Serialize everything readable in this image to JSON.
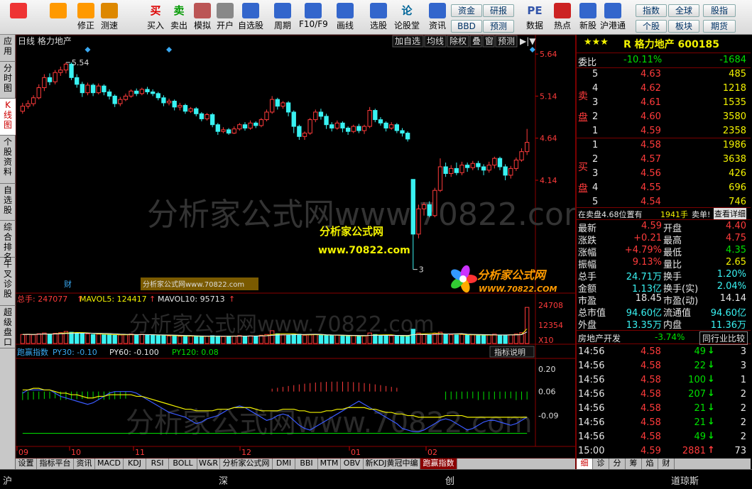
{
  "toolbar": {
    "buttons": [
      {
        "label": "",
        "icon": "app-logo-icon"
      },
      {
        "label": "",
        "icon": "back-arrow-icon"
      },
      {
        "label": "修正",
        "icon": "up-down-icon"
      },
      {
        "label": "测速",
        "icon": "speed-icon"
      },
      {
        "label": "买入",
        "icon": "buy-icon",
        "glyph": "买"
      },
      {
        "label": "卖出",
        "icon": "sell-icon",
        "glyph": "卖"
      },
      {
        "label": "模拟",
        "icon": "hammer-icon"
      },
      {
        "label": "开户",
        "icon": "lock-icon"
      },
      {
        "label": "自选股",
        "icon": "star-folder-icon"
      },
      {
        "label": "周期",
        "icon": "clock-icon"
      },
      {
        "label": "F10/F9",
        "icon": "f10-icon"
      },
      {
        "label": "画线",
        "icon": "pen-icon"
      },
      {
        "label": "选股",
        "icon": "select-stock-icon"
      },
      {
        "label": "论股堂",
        "icon": "forum-icon",
        "glyph": "论"
      },
      {
        "label": "资讯",
        "icon": "info-icon"
      },
      {
        "label": "数据",
        "icon": "data-pe-icon",
        "glyph": "PE"
      },
      {
        "label": "热点",
        "icon": "hot-icon"
      },
      {
        "label": "新股",
        "icon": "new-stock-icon"
      },
      {
        "label": "沪港通",
        "icon": "sse-hke-icon"
      }
    ],
    "small_buttons": [
      "资金",
      "研报",
      "指数",
      "全球",
      "股指",
      "BBD",
      "预测",
      "个股",
      "板块",
      "期货"
    ]
  },
  "sidetabs": [
    "应用",
    "分时图",
    "K线图",
    "个股资料",
    "自选股",
    "综合排名",
    "牛叉诊股",
    "超级盘口"
  ],
  "chart": {
    "stock_label": "日线  格力地产",
    "right_buttons": [
      "加自选",
      "均线",
      "除权",
      "叠",
      "窗",
      "预测"
    ],
    "price_axis": [
      "5.64",
      "5.14",
      "4.64",
      "4.14"
    ],
    "high_mark": "5.54",
    "low_mark": "3",
    "cai_label": "财",
    "watermark": "分析家公式网www.70822.com",
    "overlay_title": "分析家公式网",
    "overlay_url": "www.70822.com",
    "logo_text": "分析家公式网",
    "logo_url": "WWW.70822.COM",
    "small_link": "分析家公式网www.70822.com",
    "vol_legend": {
      "total": "总手: 247077",
      "ma5": "MAVOL5: 124417",
      "ma10": "MAVOL10: 95713"
    },
    "vol_axis": [
      "24708",
      "12354",
      "X10"
    ],
    "ind_legend": {
      "name": "跑赢指数",
      "py30": "PY30: -0.10",
      "py60": "PY60: -0.100",
      "py120": "PY120: 0.08"
    },
    "ind_button": "指标说明",
    "ind_axis": [
      "0.20",
      "0.06",
      "-0.09"
    ],
    "date_axis": [
      "09",
      "10",
      "11",
      "12",
      "01",
      "02"
    ]
  },
  "chart_data": {
    "type": "candlestick",
    "ylim": [
      2.9,
      5.7
    ],
    "candles": [
      [
        4.96,
        5.02,
        5.06,
        4.93
      ],
      [
        5.02,
        5.05,
        5.09,
        4.99
      ],
      [
        5.05,
        5.12,
        5.15,
        5.02
      ],
      [
        5.12,
        5.24,
        5.28,
        5.1
      ],
      [
        5.24,
        5.36,
        5.4,
        5.2
      ],
      [
        5.36,
        5.31,
        5.41,
        5.27
      ],
      [
        5.31,
        5.42,
        5.45,
        5.28
      ],
      [
        5.42,
        5.45,
        5.49,
        5.38
      ],
      [
        5.45,
        5.52,
        5.54,
        5.41
      ],
      [
        5.52,
        5.36,
        5.54,
        5.33
      ],
      [
        5.36,
        5.28,
        5.4,
        5.24
      ],
      [
        5.28,
        5.18,
        5.31,
        5.13
      ],
      [
        5.18,
        5.27,
        5.3,
        5.15
      ],
      [
        5.27,
        5.18,
        5.29,
        5.14
      ],
      [
        5.18,
        5.26,
        5.29,
        5.16
      ],
      [
        5.26,
        5.19,
        5.28,
        5.15
      ],
      [
        5.19,
        5.14,
        5.22,
        5.1
      ],
      [
        5.14,
        5.05,
        5.16,
        5.01
      ],
      [
        5.05,
        5.1,
        5.13,
        5.02
      ],
      [
        5.1,
        5.14,
        5.17,
        5.08
      ],
      [
        5.14,
        5.2,
        5.22,
        5.12
      ],
      [
        5.2,
        5.17,
        5.23,
        5.14
      ],
      [
        5.17,
        5.22,
        5.24,
        5.15
      ],
      [
        5.22,
        5.19,
        5.25,
        5.16
      ],
      [
        5.19,
        5.17,
        5.22,
        5.14
      ],
      [
        5.17,
        5.12,
        5.19,
        5.09
      ],
      [
        5.12,
        5.06,
        5.15,
        5.02
      ],
      [
        5.06,
        5.08,
        5.11,
        5.03
      ],
      [
        5.08,
        5.01,
        5.1,
        4.97
      ],
      [
        5.01,
        5.03,
        5.06,
        4.97
      ],
      [
        5.03,
        4.96,
        5.05,
        4.93
      ],
      [
        4.96,
        4.99,
        5.01,
        4.94
      ],
      [
        4.99,
        4.93,
        5.01,
        4.9
      ],
      [
        4.93,
        4.87,
        4.95,
        4.84
      ],
      [
        4.87,
        4.92,
        4.94,
        4.85
      ],
      [
        4.92,
        4.8,
        4.94,
        4.77
      ],
      [
        4.8,
        4.72,
        4.82,
        4.68
      ],
      [
        4.72,
        4.74,
        4.77,
        4.7
      ],
      [
        4.74,
        4.7,
        4.76,
        4.68
      ],
      [
        4.7,
        4.75,
        4.78,
        4.69
      ],
      [
        4.75,
        4.8,
        4.82,
        4.73
      ],
      [
        4.8,
        4.76,
        4.83,
        4.73
      ],
      [
        4.76,
        4.82,
        4.85,
        4.74
      ],
      [
        4.82,
        4.79,
        4.84,
        4.76
      ],
      [
        4.79,
        4.86,
        4.88,
        4.77
      ],
      [
        4.86,
        4.95,
        4.98,
        4.84
      ],
      [
        4.95,
        5.1,
        5.14,
        4.93
      ],
      [
        5.1,
        5.02,
        5.12,
        4.98
      ],
      [
        5.02,
        5.06,
        5.08,
        4.99
      ],
      [
        5.06,
        4.95,
        5.08,
        4.9
      ],
      [
        4.95,
        4.78,
        4.97,
        4.7
      ],
      [
        4.78,
        4.66,
        4.8,
        4.62
      ],
      [
        4.66,
        4.7,
        4.72,
        4.62
      ],
      [
        4.7,
        4.86,
        4.88,
        4.68
      ],
      [
        4.86,
        4.95,
        4.98,
        4.83
      ],
      [
        4.95,
        4.9,
        4.99,
        4.86
      ],
      [
        4.9,
        4.8,
        4.93,
        4.75
      ],
      [
        4.8,
        4.76,
        4.83,
        4.72
      ],
      [
        4.76,
        4.82,
        4.85,
        4.74
      ],
      [
        4.82,
        4.76,
        4.84,
        4.71
      ],
      [
        4.76,
        4.72,
        4.78,
        4.68
      ],
      [
        4.72,
        4.78,
        4.8,
        4.7
      ],
      [
        4.78,
        4.73,
        4.81,
        4.7
      ],
      [
        4.73,
        4.78,
        4.8,
        4.69
      ],
      [
        4.78,
        4.97,
        5.01,
        4.76
      ],
      [
        4.97,
        4.86,
        4.99,
        4.83
      ],
      [
        4.86,
        4.82,
        4.89,
        4.79
      ],
      [
        4.82,
        4.76,
        4.84,
        4.72
      ],
      [
        4.76,
        4.8,
        4.83,
        4.74
      ],
      [
        4.8,
        4.73,
        4.82,
        4.7
      ],
      [
        4.73,
        4.7,
        4.76,
        4.66
      ],
      [
        4.7,
        4.63,
        4.72,
        4.6
      ],
      [
        4.15,
        3.5,
        4.15,
        3.08
      ],
      [
        3.5,
        3.8,
        3.85,
        3.45
      ],
      [
        3.8,
        3.85,
        3.88,
        3.72
      ],
      [
        3.85,
        3.72,
        3.89,
        3.7
      ],
      [
        3.72,
        4.02,
        4.05,
        3.7
      ],
      [
        4.02,
        4.3,
        4.4,
        4.0
      ],
      [
        4.3,
        4.22,
        4.35,
        4.18
      ],
      [
        4.22,
        4.28,
        4.32,
        4.18
      ],
      [
        4.28,
        4.23,
        4.35,
        4.2
      ],
      [
        4.23,
        4.32,
        4.36,
        4.2
      ],
      [
        4.32,
        4.29,
        4.35,
        4.24
      ],
      [
        4.29,
        4.34,
        4.37,
        4.26
      ],
      [
        4.34,
        4.3,
        4.37,
        4.26
      ],
      [
        4.3,
        4.26,
        4.33,
        4.2
      ],
      [
        4.26,
        4.32,
        4.36,
        4.23
      ],
      [
        4.32,
        4.4,
        4.42,
        4.28
      ],
      [
        4.4,
        4.3,
        4.42,
        4.26
      ],
      [
        4.3,
        4.2,
        4.33,
        4.14
      ],
      [
        4.2,
        4.28,
        4.31,
        4.16
      ],
      [
        4.28,
        4.38,
        4.41,
        4.25
      ],
      [
        4.38,
        4.48,
        4.52,
        4.36
      ],
      [
        4.48,
        4.59,
        4.75,
        4.44
      ]
    ],
    "volume": [
      60,
      62,
      58,
      65,
      70,
      60,
      68,
      72,
      80,
      75,
      70,
      66,
      64,
      60,
      62,
      58,
      60,
      55,
      57,
      60,
      63,
      58,
      61,
      57,
      55,
      52,
      54,
      50,
      52,
      48,
      50,
      49,
      47,
      46,
      48,
      52,
      50,
      46,
      48,
      50,
      53,
      49,
      51,
      48,
      55,
      60,
      85,
      65,
      58,
      55,
      60,
      62,
      55,
      58,
      60,
      56,
      54,
      52,
      55,
      50,
      49,
      52,
      50,
      51,
      70,
      60,
      55,
      52,
      51,
      50,
      49,
      48,
      95,
      70,
      60,
      58,
      65,
      75,
      60,
      58,
      57,
      60,
      56,
      58,
      55,
      53,
      57,
      62,
      56,
      55,
      58,
      63,
      72,
      240
    ],
    "volume_ylim": [
      0,
      250
    ],
    "vol_series": [
      {
        "name": "MAVOL5"
      },
      {
        "name": "MAVOL10"
      }
    ],
    "indicator": {
      "ylim": [
        -0.26,
        0.24
      ],
      "py30": [
        0.05,
        0.07,
        0.07,
        0.07,
        0.07,
        0.07,
        0.05,
        0.03,
        0.02,
        0.01,
        0.0,
        -0.01,
        -0.02,
        -0.01,
        0.01,
        0.03,
        0.05,
        0.06,
        0.06,
        0.06,
        0.06,
        0.05,
        0.03,
        0.01,
        -0.01,
        -0.03,
        -0.05,
        -0.07,
        -0.08,
        -0.09,
        -0.1,
        -0.12,
        -0.14,
        -0.13,
        -0.11,
        -0.1,
        -0.09,
        -0.07,
        -0.05,
        -0.04,
        -0.03,
        -0.04,
        -0.06,
        -0.08,
        -0.1,
        -0.12,
        -0.11,
        -0.09,
        -0.08,
        -0.09,
        -0.12,
        -0.15,
        -0.17,
        -0.18,
        -0.16,
        -0.14,
        -0.12,
        -0.1,
        -0.08,
        -0.06,
        -0.04,
        -0.02,
        0.0,
        -0.02,
        -0.04,
        -0.06,
        -0.08,
        -0.1,
        -0.12,
        -0.14,
        -0.17,
        -0.18,
        -0.19,
        -0.19,
        -0.18,
        -0.16,
        -0.14,
        -0.12,
        -0.11,
        -0.12,
        -0.14,
        -0.16,
        -0.18,
        -0.17,
        -0.15,
        -0.13,
        -0.12,
        -0.12,
        -0.13,
        -0.14,
        -0.15,
        -0.14,
        -0.12,
        -0.1
      ],
      "py60": [
        0.07,
        0.07,
        0.08,
        0.08,
        0.07,
        0.07,
        0.06,
        0.05,
        0.05,
        0.04,
        0.04,
        0.03,
        0.02,
        0.02,
        0.03,
        0.03,
        0.04,
        0.04,
        0.04,
        0.04,
        0.04,
        0.03,
        0.03,
        0.02,
        0.01,
        0.0,
        -0.01,
        -0.02,
        -0.03,
        -0.04,
        -0.05,
        -0.05,
        -0.06,
        -0.06,
        -0.06,
        -0.06,
        -0.05,
        -0.05,
        -0.05,
        -0.04,
        -0.04,
        -0.04,
        -0.04,
        -0.05,
        -0.06,
        -0.06,
        -0.06,
        -0.06,
        -0.05,
        -0.05,
        -0.05,
        -0.06,
        -0.06,
        -0.07,
        -0.07,
        -0.07,
        -0.06,
        -0.06,
        -0.05,
        -0.05,
        -0.04,
        -0.04,
        -0.04,
        -0.04,
        -0.05,
        -0.05,
        -0.06,
        -0.07,
        -0.07,
        -0.08,
        -0.08,
        -0.09,
        -0.09,
        -0.1,
        -0.1,
        -0.1,
        -0.1,
        -0.1,
        -0.09,
        -0.09,
        -0.09,
        -0.09,
        -0.1,
        -0.1,
        -0.1,
        -0.1,
        -0.1,
        -0.1,
        -0.1,
        -0.1,
        -0.1,
        -0.1,
        -0.1,
        -0.1
      ],
      "py120": 0.08,
      "hist": [
        0.0,
        0.0,
        0.0,
        -0.02,
        -0.02,
        -0.03,
        -0.02,
        -0.02,
        -0.02,
        -0.02,
        -0.02,
        -0.02,
        -0.02,
        -0.02,
        -0.02,
        -0.02,
        -0.02,
        -0.02,
        -0.02,
        -0.02,
        -0.01,
        -0.01,
        -0.01,
        -0.01,
        -0.01,
        0.0,
        0.0,
        0.0,
        0.0,
        0.0,
        0.0,
        0.0,
        0.0,
        0.0,
        0.0,
        0.0,
        0.0,
        0.0,
        0.0,
        0.0,
        0.0,
        0.0,
        0.0,
        0.0,
        0.0,
        0.0,
        0.0,
        0.0,
        0.0,
        0.0,
        0.0,
        0.0,
        0.0,
        0.0,
        0.0,
        0.0,
        0.0,
        0.0,
        0.0,
        0.0,
        0.0,
        0.0,
        0.0,
        0.0,
        0.0,
        0.0,
        0.0,
        0.0,
        0.0,
        0.0,
        0.0,
        0.0,
        0.0,
        0.0,
        0.0,
        0.0,
        0.0,
        0.0,
        0.0,
        0.0,
        0.0,
        0.0,
        0.0,
        0.0,
        0.0,
        0.0,
        0.0,
        0.0,
        0.0,
        0.0,
        0.0,
        0.0,
        0.0,
        0.0
      ],
      "hist_pos": [
        0,
        0,
        0,
        0,
        0,
        0,
        0,
        0,
        0,
        0,
        0,
        0,
        0,
        0,
        0,
        0,
        0,
        0,
        0,
        0,
        0,
        0,
        0,
        0,
        0,
        0,
        0,
        0,
        0,
        0,
        0,
        0,
        0,
        0,
        0,
        0,
        0,
        0,
        0,
        0,
        0,
        0,
        0,
        0,
        0,
        0,
        0,
        0,
        0,
        0,
        0,
        0,
        0,
        0,
        0,
        0,
        0,
        0,
        0,
        0,
        0,
        0,
        0,
        0,
        0,
        0,
        0,
        0,
        0,
        0,
        0,
        0,
        0,
        0,
        0,
        0,
        0,
        0,
        0,
        0,
        0,
        0,
        0,
        0,
        0,
        0,
        0,
        0,
        0,
        0,
        0,
        0,
        0,
        0
      ]
    }
  },
  "right": {
    "title": "R 格力地产 600185",
    "stars": "★★★",
    "weibi": {
      "label": "委比",
      "pct": "-10.11%",
      "val": "-1684"
    },
    "sell_label": "卖盘",
    "buy_label": "买盘",
    "asks": [
      {
        "lv": "5",
        "p": "4.63",
        "v": "485"
      },
      {
        "lv": "4",
        "p": "4.62",
        "v": "1218"
      },
      {
        "lv": "3",
        "p": "4.61",
        "v": "1535"
      },
      {
        "lv": "2",
        "p": "4.60",
        "v": "3580"
      },
      {
        "lv": "1",
        "p": "4.59",
        "v": "2358"
      }
    ],
    "bids": [
      {
        "lv": "1",
        "p": "4.58",
        "v": "1986"
      },
      {
        "lv": "2",
        "p": "4.57",
        "v": "3638"
      },
      {
        "lv": "3",
        "p": "4.56",
        "v": "426"
      },
      {
        "lv": "4",
        "p": "4.55",
        "v": "696"
      },
      {
        "lv": "5",
        "p": "4.54",
        "v": "746"
      }
    ],
    "order_line": {
      "a": "在卖盘4.68位置有",
      "b": "1941手",
      "c": "卖单!",
      "d": "查看详细"
    },
    "stats": [
      {
        "l1": "最新",
        "v1": "4.59",
        "l2": "开盘",
        "v2": "4.40"
      },
      {
        "l1": "涨跌",
        "v1": "+0.21",
        "l2": "最高",
        "v2": "4.75"
      },
      {
        "l1": "涨幅",
        "v1": "+4.79%",
        "l2": "最低",
        "v2": "4.35"
      },
      {
        "l1": "振幅",
        "v1": "9.13%",
        "l2": "量比",
        "v2": "2.65"
      },
      {
        "l1": "总手",
        "v1": "24.71万",
        "l2": "换手",
        "v2": "1.20%"
      },
      {
        "l1": "金额",
        "v1": "1.13亿",
        "l2": "换手(实)",
        "v2": "2.04%"
      },
      {
        "l1": "市盈",
        "v1": "18.45",
        "l2": "市盈(动)",
        "v2": "14.14"
      },
      {
        "l1": "总市值",
        "v1": "94.60亿",
        "l2": "流通值",
        "v2": "94.60亿"
      },
      {
        "l1": "外盘",
        "v1": "13.35万",
        "l2": "内盘",
        "v2": "11.36万"
      }
    ],
    "sector": {
      "name": "房地产开发",
      "pct": "-3.74%",
      "btn": "同行业比较"
    },
    "ticks": [
      {
        "t": "14:56",
        "p": "4.58",
        "v": "49",
        "d": "↓",
        "n": "3"
      },
      {
        "t": "14:56",
        "p": "4.58",
        "v": "22",
        "d": "↓",
        "n": "3"
      },
      {
        "t": "14:56",
        "p": "4.58",
        "v": "100",
        "d": "↓",
        "n": "1"
      },
      {
        "t": "14:56",
        "p": "4.58",
        "v": "207",
        "d": "↓",
        "n": "2"
      },
      {
        "t": "14:56",
        "p": "4.58",
        "v": "21",
        "d": "↓",
        "n": "2"
      },
      {
        "t": "14:56",
        "p": "4.58",
        "v": "21",
        "d": "↓",
        "n": "2"
      },
      {
        "t": "14:56",
        "p": "4.58",
        "v": "49",
        "d": "↓",
        "n": "2"
      },
      {
        "t": "15:00",
        "p": "4.59",
        "v": "2881",
        "d": "↑",
        "n": "73"
      }
    ],
    "tabs": [
      "细",
      "诊",
      "分",
      "筹",
      "焰",
      "财"
    ]
  },
  "bottom_tabs": [
    "设置",
    "指标平台",
    "资讯",
    "MACD",
    "KDJ",
    "RSI",
    "BOLL",
    "W&R",
    "分析家公式网",
    "DMI",
    "BBI",
    "MTM",
    "OBV",
    "新KDJ黄冠中编制",
    "跑赢指数"
  ],
  "status": {
    "a": "沪",
    "b": "深",
    "c": "创",
    "d": "道琼斯"
  }
}
